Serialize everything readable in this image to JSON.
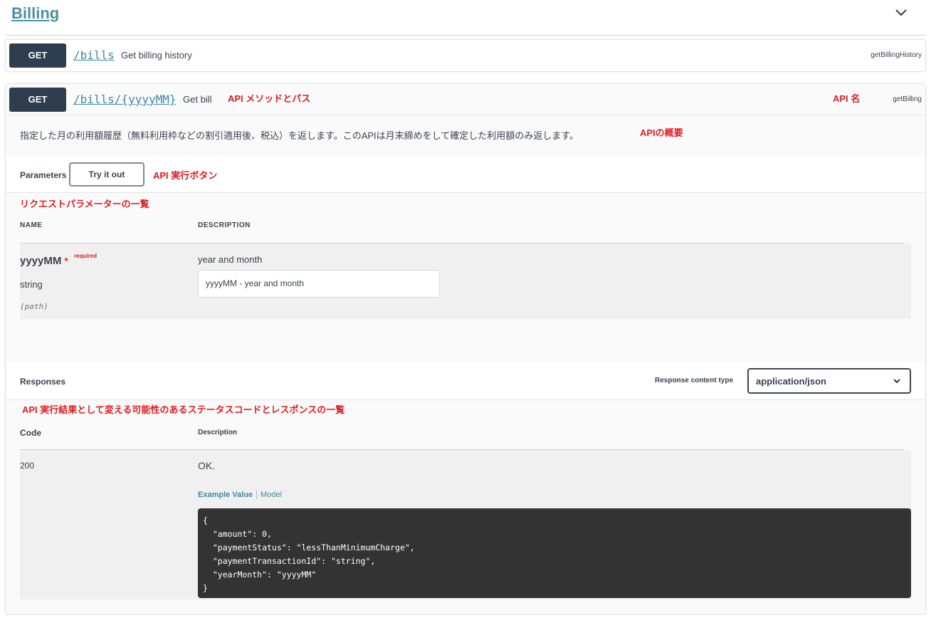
{
  "tag": {
    "title": "Billing"
  },
  "operations": [
    {
      "method": "GET",
      "path": "/bills",
      "summary": "Get billing history",
      "operation_id": "getBillingHistory"
    },
    {
      "method": "GET",
      "path": "/bills/{yyyyMM}",
      "summary": "Get bill",
      "operation_id": "getBilling",
      "description": "指定した月の利用額履歴（無料利用枠などの割引適用後、税込）を返します。このAPIは月末締めをして確定した利用額のみ返します。"
    }
  ],
  "annotations": {
    "method_path": "API メソッドとパス",
    "api_name": "API 名",
    "overview": "APIの概要",
    "try_button": "API 実行ボタン",
    "param_list": "リクエストパラメーターの一覧",
    "response_list": "API 実行結果として変える可能性のあるステータスコードとレスポンスの一覧"
  },
  "parameters": {
    "label": "Parameters",
    "try_label": "Try it out",
    "col_name": "NAME",
    "col_description": "DESCRIPTION",
    "items": [
      {
        "name": "yyyyMM",
        "star": "*",
        "required": "required",
        "type": "string",
        "in": "(path)",
        "description": "year and month",
        "placeholder": "yyyyMM - year and month"
      }
    ]
  },
  "responses": {
    "label": "Responses",
    "content_type_label": "Response content type",
    "content_type": "application/json",
    "col_code": "Code",
    "col_description": "Description",
    "items": [
      {
        "code": "200",
        "description": "OK.",
        "example_tab": "Example Value",
        "model_tab": "Model",
        "example_lines": [
          "{",
          "  \"amount\": 0,",
          "  \"paymentStatus\": \"lessThanMinimumCharge\",",
          "  \"paymentTransactionId\": \"string\",",
          "  \"yearMonth\": \"yyyyMM\"",
          "}"
        ]
      }
    ]
  },
  "icons": {
    "collapse": "chevron-down-icon",
    "select": "chevron-down-icon"
  },
  "colors": {
    "method_bg": "#2f3e4e",
    "link": "#3f89a6",
    "annotation": "#e0191e",
    "code_bg": "#333333"
  }
}
